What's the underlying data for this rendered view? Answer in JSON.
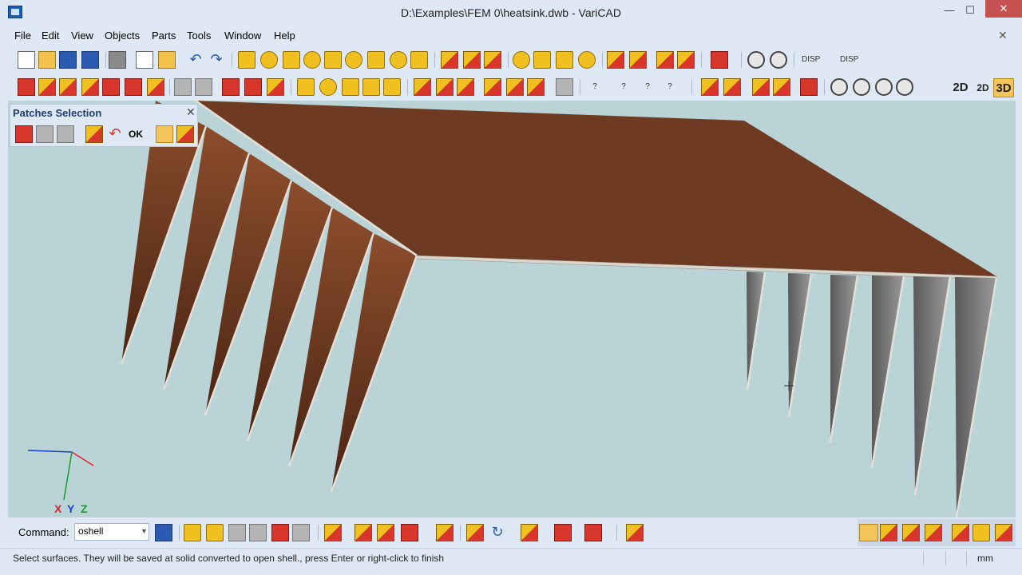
{
  "window": {
    "title": "D:\\Examples\\FEM 0\\heatsink.dwb - VariCAD",
    "min_glyph": "—",
    "max_glyph": "☐",
    "close_glyph": "✕",
    "mdi_close_glyph": "✕"
  },
  "menu": {
    "items": [
      "File",
      "Edit",
      "View",
      "Objects",
      "Parts",
      "Tools",
      "Window",
      "Help"
    ]
  },
  "toolbar": {
    "disp_label": "DISP",
    "disp_label_2": "DISP",
    "view_modes": [
      "2D",
      "2D",
      "3D"
    ],
    "active_mode": "3D"
  },
  "patches_panel": {
    "title": "Patches Selection",
    "ok_label": "OK",
    "close_glyph": "✕"
  },
  "axis": {
    "x_label": "X",
    "y_label": "Y",
    "z_label": "Z",
    "x_color": "#e0202a",
    "y_color": "#1a44c8",
    "z_color": "#1a9a2a"
  },
  "command": {
    "label": "Command:",
    "value": "oshell"
  },
  "status": {
    "message": "Select surfaces. They will be saved at solid converted to open shell., press Enter or right-click to finish",
    "unit": "mm"
  },
  "colors": {
    "viewport_bg": "#b9d3d6",
    "selected_surface": "#6e3b22",
    "unselected_surface": "#7b7b7b",
    "ui_bg": "#dfe9f5",
    "highlight": "#f3c45a"
  }
}
